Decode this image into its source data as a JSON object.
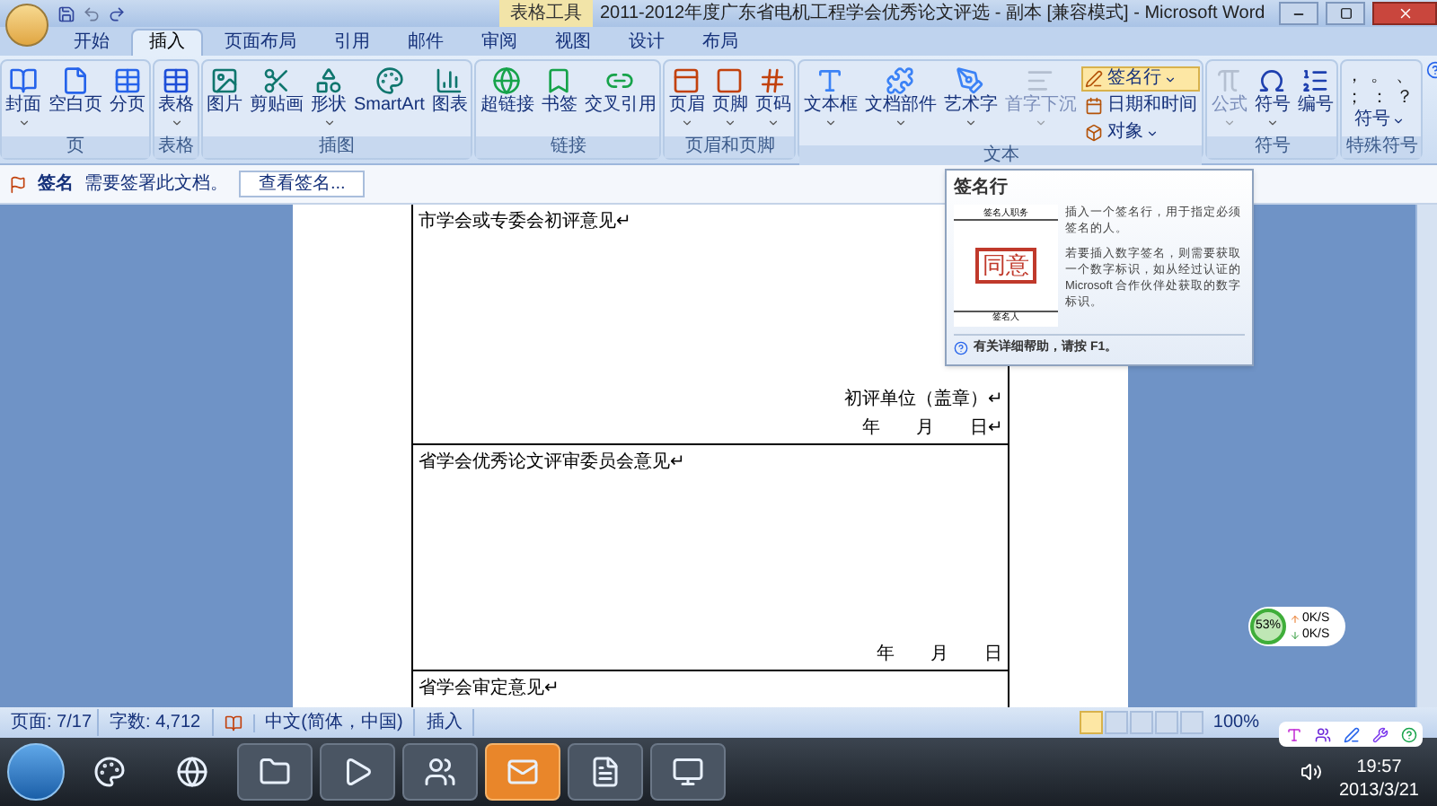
{
  "window": {
    "title": "2011-2012年度广东省电机工程学会优秀论文评选 - 副本 [兼容模式] - Microsoft Word",
    "context_tab_group": "表格工具"
  },
  "tabs": [
    {
      "label": "开始",
      "selected": false
    },
    {
      "label": "插入",
      "selected": true
    },
    {
      "label": "页面布局",
      "selected": false
    },
    {
      "label": "引用",
      "selected": false
    },
    {
      "label": "邮件",
      "selected": false
    },
    {
      "label": "审阅",
      "selected": false
    },
    {
      "label": "视图",
      "selected": false
    },
    {
      "label": "设计",
      "selected": false
    },
    {
      "label": "布局",
      "selected": false
    }
  ],
  "ribbon_groups": [
    {
      "label": "页",
      "buttons": [
        {
          "label": "封面",
          "dropdown": true,
          "disabled": false
        },
        {
          "label": "空白页",
          "dropdown": false,
          "disabled": false
        },
        {
          "label": "分页",
          "dropdown": false,
          "disabled": false
        }
      ]
    },
    {
      "label": "表格",
      "buttons": [
        {
          "label": "表格",
          "dropdown": true,
          "disabled": false
        }
      ]
    },
    {
      "label": "插图",
      "buttons": [
        {
          "label": "图片",
          "dropdown": false,
          "disabled": false
        },
        {
          "label": "剪贴画",
          "dropdown": false,
          "disabled": false
        },
        {
          "label": "形状",
          "dropdown": true,
          "disabled": false
        },
        {
          "label": "SmartArt",
          "dropdown": false,
          "disabled": false
        },
        {
          "label": "图表",
          "dropdown": false,
          "disabled": false
        }
      ]
    },
    {
      "label": "链接",
      "buttons": [
        {
          "label": "超链接",
          "dropdown": false,
          "disabled": false
        },
        {
          "label": "书签",
          "dropdown": false,
          "disabled": false
        },
        {
          "label": "交叉引用",
          "dropdown": false,
          "disabled": false
        }
      ]
    },
    {
      "label": "页眉和页脚",
      "buttons": [
        {
          "label": "页眉",
          "dropdown": true,
          "disabled": false
        },
        {
          "label": "页脚",
          "dropdown": true,
          "disabled": false
        },
        {
          "label": "页码",
          "dropdown": true,
          "disabled": false
        }
      ]
    },
    {
      "label": "文本",
      "buttons": [
        {
          "label": "文本框",
          "dropdown": true,
          "disabled": false
        },
        {
          "label": "文档部件",
          "dropdown": true,
          "disabled": false
        },
        {
          "label": "艺术字",
          "dropdown": true,
          "disabled": false
        },
        {
          "label": "首字下沉",
          "dropdown": true,
          "disabled": true
        }
      ],
      "small_buttons": [
        {
          "label": "签名行",
          "dropdown": true,
          "selected": true
        },
        {
          "label": "日期和时间",
          "dropdown": false,
          "selected": false
        },
        {
          "label": "对象",
          "dropdown": true,
          "selected": false
        }
      ]
    },
    {
      "label": "符号",
      "buttons": [
        {
          "label": "公式",
          "dropdown": true,
          "disabled": true
        },
        {
          "label": "符号",
          "dropdown": true,
          "disabled": false
        },
        {
          "label": "编号",
          "dropdown": false,
          "disabled": false
        }
      ]
    },
    {
      "label": "特殊符号",
      "symbols": [
        "，",
        "。",
        "、",
        "；",
        "：",
        "？"
      ],
      "menu_button": "符号"
    }
  ],
  "message_bar": {
    "title": "签名",
    "text": "需要签署此文档。",
    "button": "查看签名..."
  },
  "document": {
    "cells": [
      {
        "heading": "市学会或专委会初评意见↵",
        "lines": [
          "初评单位（盖章）↵",
          "年　　月　　日↵"
        ]
      },
      {
        "heading": "省学会优秀论文评审委员会意见↵",
        "lines": [
          "年　　月　　日"
        ]
      },
      {
        "heading": "省学会审定意见↵"
      }
    ]
  },
  "tooltip": {
    "title": "签名行",
    "image_title": "签名人职务",
    "image_stamp": "同意",
    "image_signer": "签名人",
    "paragraphs": [
      "插入一个签名行，用于指定必须签名的人。",
      "若要插入数字签名，则需要获取一个数字标识，如从经过认证的 Microsoft 合作伙伴处获取的数字标识。"
    ],
    "help": "有关详细帮助，请按 F1。"
  },
  "net_widget": {
    "percent": "53%",
    "upload": "0K/S",
    "download": "0K/S"
  },
  "status_bar": {
    "page": "页面: 7/17",
    "words": "字数: 4,712",
    "language": "中文(简体，中国)",
    "mode": "插入",
    "views": [
      {
        "selected": true
      },
      {
        "selected": false
      },
      {
        "selected": false
      },
      {
        "selected": false
      },
      {
        "selected": false
      }
    ],
    "zoom": "100%"
  },
  "taskbar": {
    "apps": [
      {
        "selected": false
      },
      {
        "selected": false
      },
      {
        "selected": false
      },
      {
        "selected": false
      },
      {
        "selected": false
      },
      {
        "selected": true
      },
      {
        "selected": false
      },
      {
        "selected": false
      }
    ],
    "time": "19:57",
    "date": "2013/3/21"
  }
}
